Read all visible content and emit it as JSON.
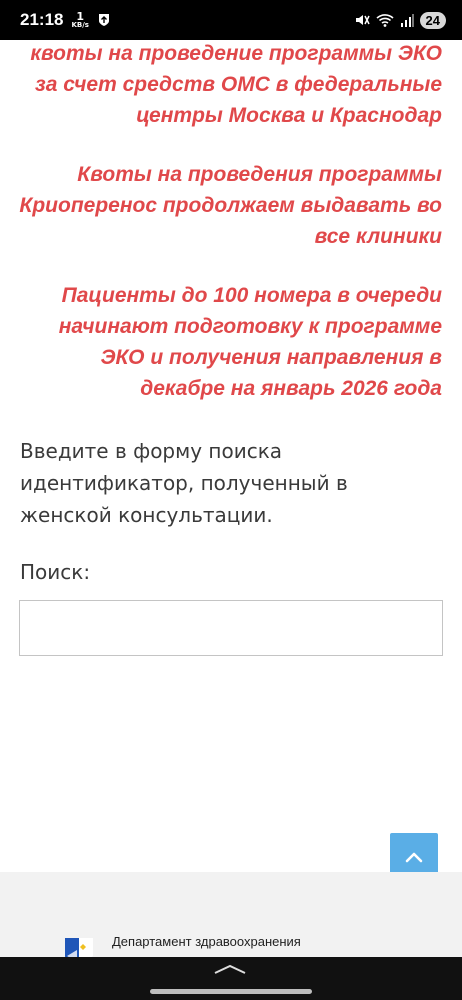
{
  "status_bar": {
    "time": "21:18",
    "net_speed_value": "1",
    "net_speed_unit": "KB/s",
    "battery": "24"
  },
  "announcements": [
    "квоты на проведение программы ЭКО за счет средств ОМС в федеральные центры Москва и Краснодар",
    "Квоты на проведения программы Криоперенос продолжаем выдавать во все клиники",
    "Пациенты до 100 номера в очереди начинают подготовку к программе ЭКО и получения направления в декабре на январь 2026 года"
  ],
  "instruction_text": "Введите в форму поиска идентификатор, полученный в женской консультации.",
  "search": {
    "label": "Поиск:",
    "value": "",
    "placeholder": ""
  },
  "footer": {
    "org_text": "Департамент здравоохранения"
  },
  "colors": {
    "announcement": "#e0484a",
    "scroll_button": "#5aaee6",
    "footer_bg": "#f2f2f2"
  },
  "icons": {
    "scroll_top": "chevron-up-icon",
    "logo": "coat-of-arms-icon"
  }
}
